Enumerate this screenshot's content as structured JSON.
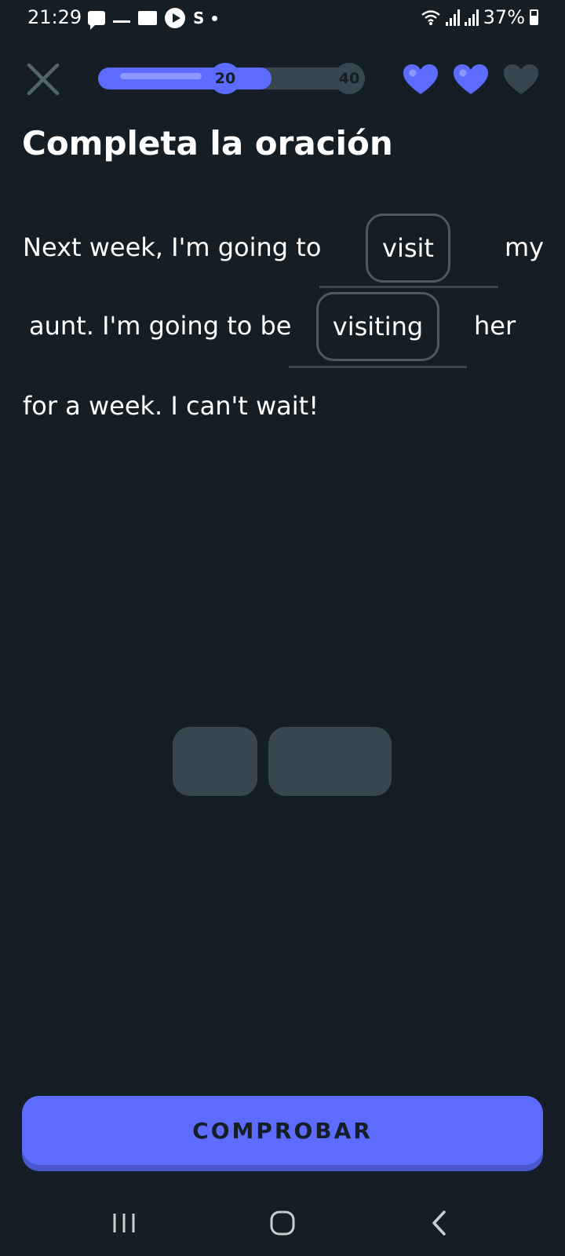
{
  "status_bar": {
    "time": "21:29",
    "battery": "37%"
  },
  "header": {
    "progress_fraction": 0.65,
    "milestone_current": "20",
    "milestone_next": "40",
    "hearts_filled": 2,
    "hearts_total": 3
  },
  "title": "Completa la oración",
  "sentence": {
    "line1_a": "Next week, I'm going to",
    "blank1": "visit",
    "line1_b": "my",
    "line2_a": "aunt. I'm going to be",
    "blank2": "visiting",
    "line2_b": "her",
    "line3": "for a week. I can't wait!"
  },
  "check_button_label": "COMPROBAR",
  "colors": {
    "background": "#151E24",
    "accent": "#5E6BFF",
    "tile": "#37464F"
  },
  "icons": [
    "close-icon",
    "heart-icon",
    "recents-icon",
    "home-icon",
    "back-icon"
  ]
}
